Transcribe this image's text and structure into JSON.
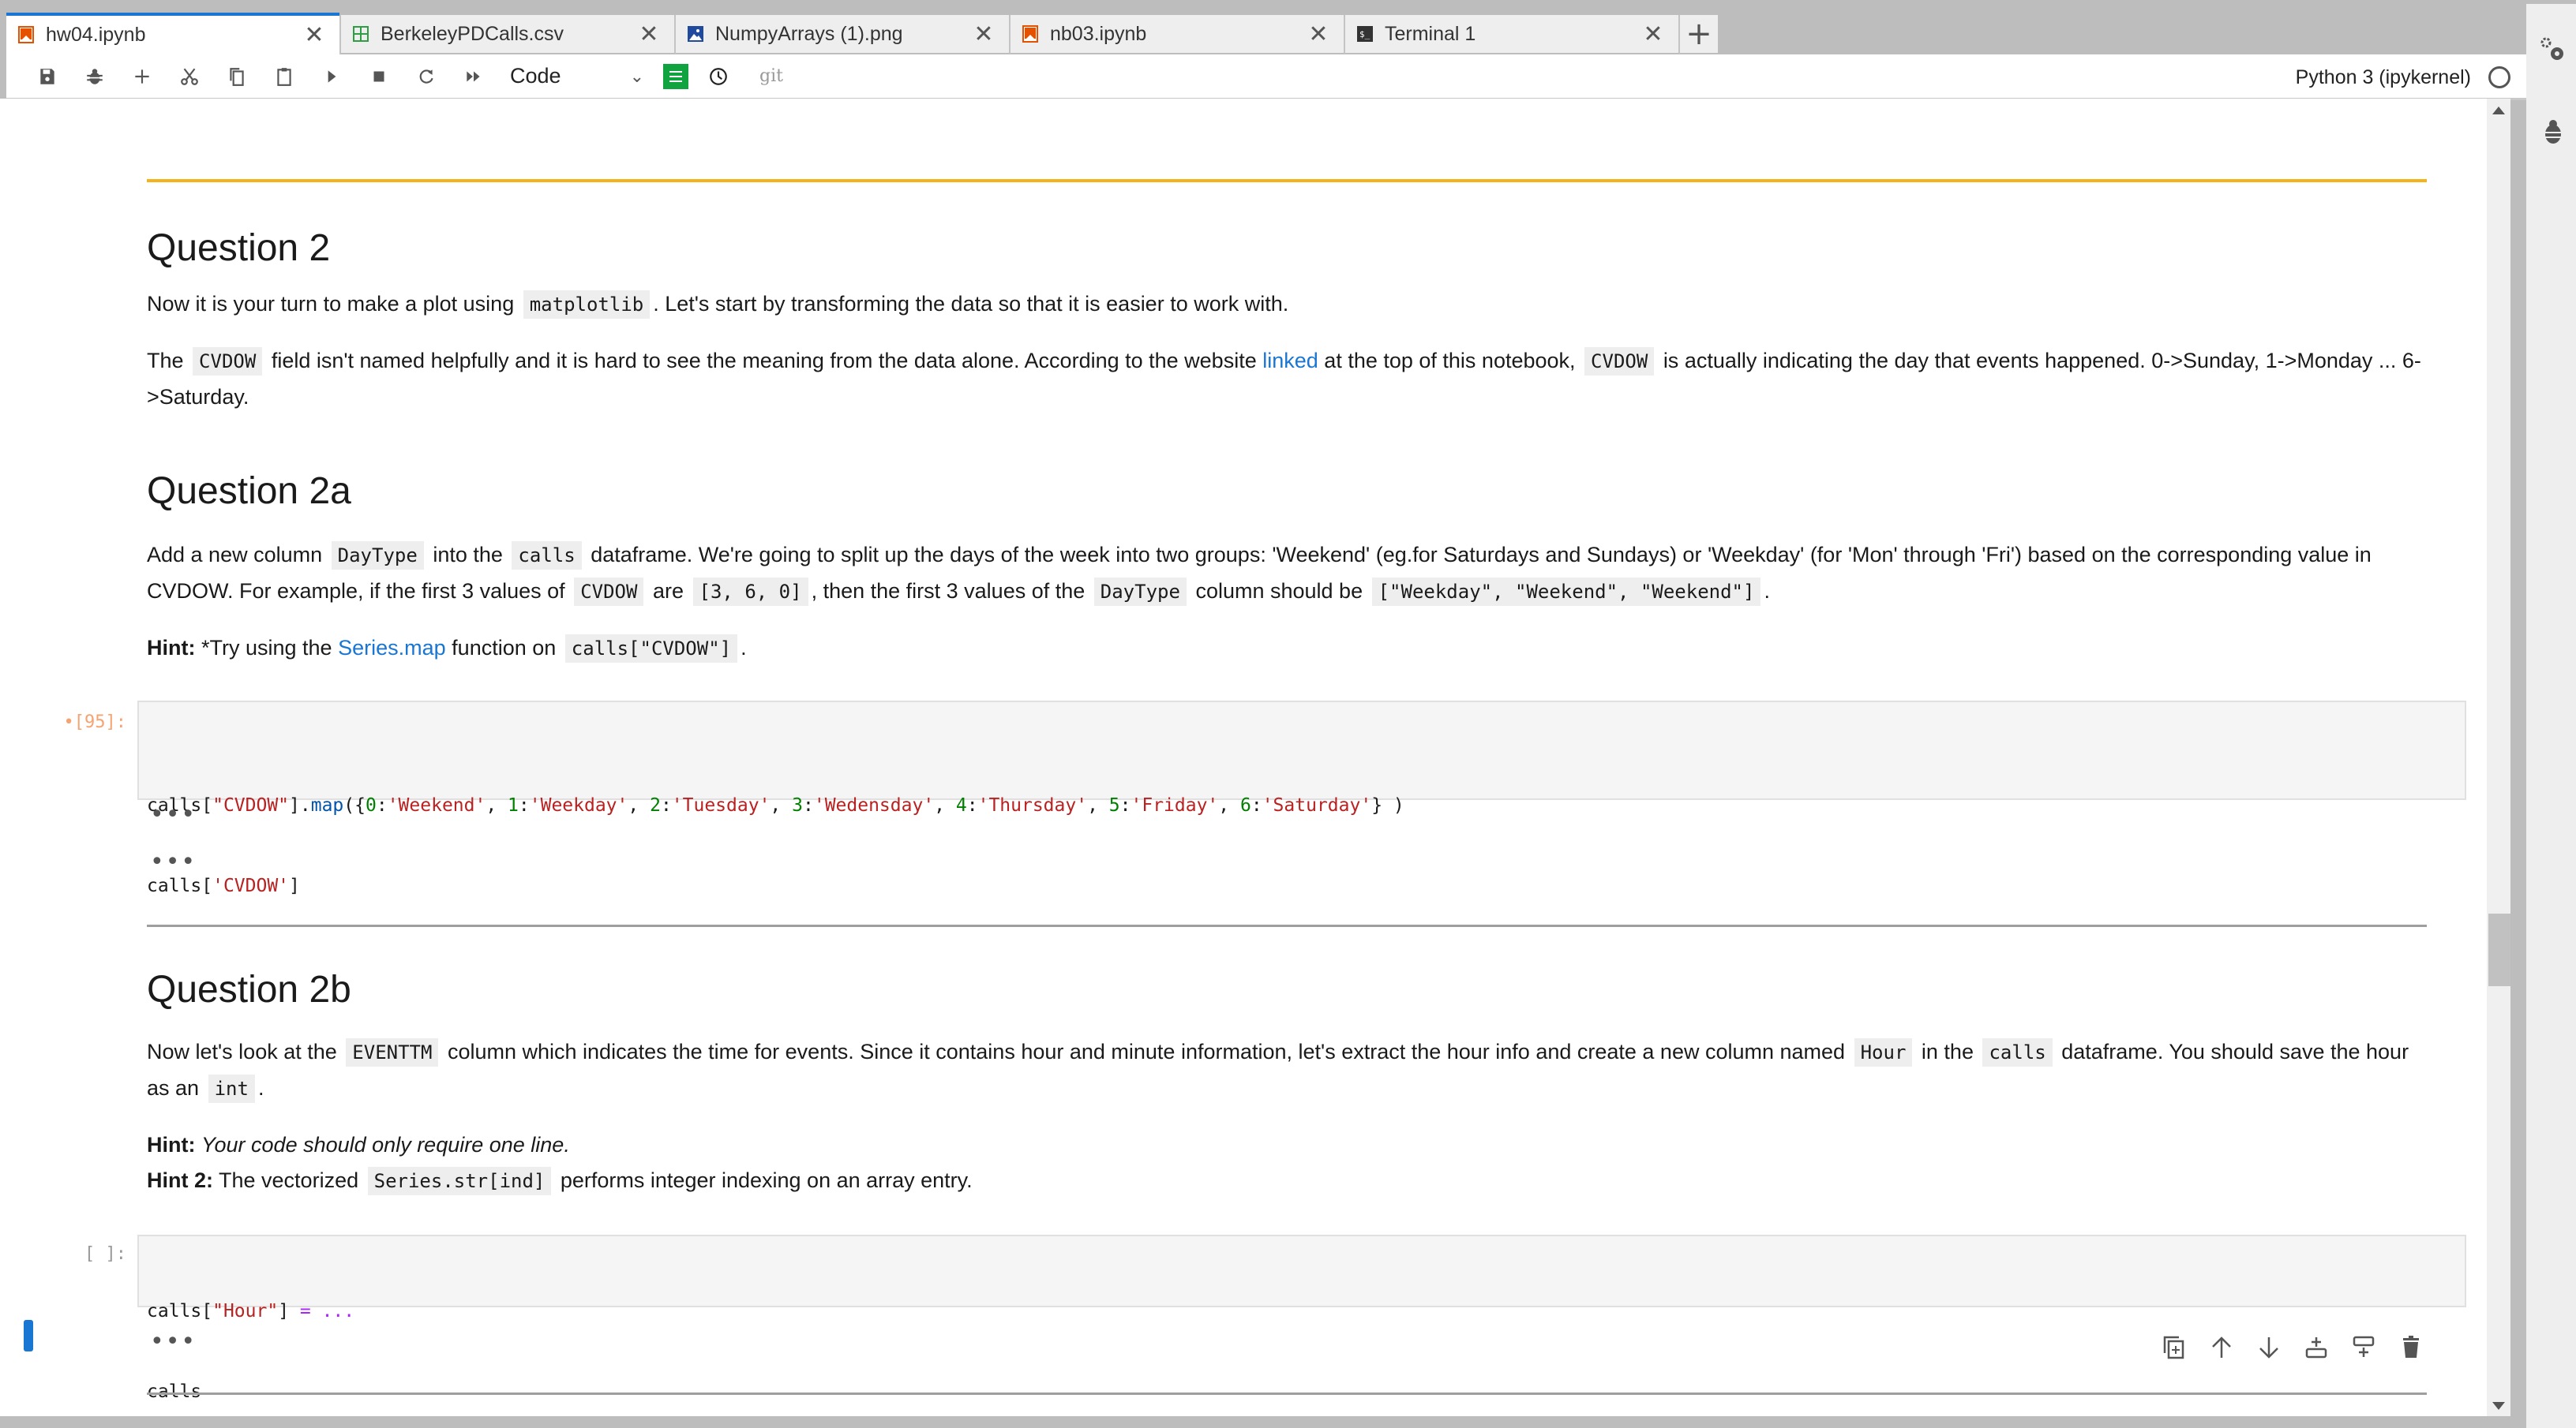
{
  "tabs": [
    {
      "label": "hw04.ipynb",
      "icon": "notebook-icon",
      "active": true
    },
    {
      "label": "BerkeleyPDCalls.csv",
      "icon": "spreadsheet-icon",
      "active": false
    },
    {
      "label": "NumpyArrays (1).png",
      "icon": "image-icon",
      "active": false
    },
    {
      "label": "nb03.ipynb",
      "icon": "notebook-icon",
      "active": false
    },
    {
      "label": "Terminal 1",
      "icon": "terminal-icon",
      "active": false
    }
  ],
  "tab_close_glyph": "✕",
  "tab_add_glyph": "+",
  "toolbar": {
    "buttons": [
      "save",
      "debug",
      "add-cell",
      "cut",
      "copy",
      "paste",
      "run",
      "stop",
      "restart",
      "run-all"
    ],
    "cell_type": "Code",
    "git_label": "git",
    "kernel_name": "Python 3 (ipykernel)"
  },
  "notebook": {
    "q2": {
      "heading": "Question 2",
      "p1_before": "Now it is your turn to make a plot using",
      "p1_code": "matplotlib",
      "p1_after": ". Let's start by transforming the data so that it is easier to work with.",
      "p2_a": "The",
      "p2_code1": "CVDOW",
      "p2_b": "field isn't named helpfully and it is hard to see the meaning from the data alone. According to the website",
      "p2_link": "linked",
      "p2_c": "at the top of this notebook,",
      "p2_code2": "CVDOW",
      "p2_d": "is actually indicating the day that events happened. 0->Sunday, 1->Monday ... 6->Saturday."
    },
    "q2a": {
      "heading": "Question 2a",
      "p1_a": "Add a new column",
      "p1_code1": "DayType",
      "p1_b": "into the",
      "p1_code2": "calls",
      "p1_c": "dataframe. We're going to split up the days of the week into two groups: 'Weekend' (eg.for Saturdays and Sundays) or 'Weekday' (for 'Mon' through 'Fri') based on the corresponding value in CVDOW. For example, if the first 3 values of",
      "p1_code3": "CVDOW",
      "p1_d": "are",
      "p1_code4": "[3, 6, 0]",
      "p1_e": ", then the first 3 values of the",
      "p1_code5": "DayType",
      "p1_f": "column should be",
      "p1_code6": "[\"Weekday\", \"Weekend\", \"Weekend\"]",
      "p1_g": ".",
      "hint_label": "Hint:",
      "hint_a": "*Try using the",
      "hint_link": "Series.map",
      "hint_b": "function on",
      "hint_code": "calls[\"CVDOW\"]",
      "hint_c": "."
    },
    "cell1": {
      "prompt": "•[95]:",
      "line1": [
        {
          "t": "calls[",
          "c": ""
        },
        {
          "t": "\"CVDOW\"",
          "c": "s"
        },
        {
          "t": "].",
          "c": ""
        },
        {
          "t": "map",
          "c": "f"
        },
        {
          "t": "({",
          "c": ""
        },
        {
          "t": "0",
          "c": "n"
        },
        {
          "t": ":",
          "c": ""
        },
        {
          "t": "'Weekend'",
          "c": "s"
        },
        {
          "t": ", ",
          "c": ""
        },
        {
          "t": "1",
          "c": "n"
        },
        {
          "t": ":",
          "c": ""
        },
        {
          "t": "'Weekday'",
          "c": "s"
        },
        {
          "t": ", ",
          "c": ""
        },
        {
          "t": "2",
          "c": "n"
        },
        {
          "t": ":",
          "c": ""
        },
        {
          "t": "'Tuesday'",
          "c": "s"
        },
        {
          "t": ", ",
          "c": ""
        },
        {
          "t": "3",
          "c": "n"
        },
        {
          "t": ":",
          "c": ""
        },
        {
          "t": "'Wedensday'",
          "c": "s"
        },
        {
          "t": ", ",
          "c": ""
        },
        {
          "t": "4",
          "c": "n"
        },
        {
          "t": ":",
          "c": ""
        },
        {
          "t": "'Thursday'",
          "c": "s"
        },
        {
          "t": ", ",
          "c": ""
        },
        {
          "t": "5",
          "c": "n"
        },
        {
          "t": ":",
          "c": ""
        },
        {
          "t": "'Friday'",
          "c": "s"
        },
        {
          "t": ", ",
          "c": ""
        },
        {
          "t": "6",
          "c": "n"
        },
        {
          "t": ":",
          "c": ""
        },
        {
          "t": "'Saturday'",
          "c": "s"
        },
        {
          "t": "} )",
          "c": ""
        }
      ],
      "line2": [
        {
          "t": "calls[",
          "c": ""
        },
        {
          "t": "'CVDOW'",
          "c": "s"
        },
        {
          "t": "]",
          "c": ""
        }
      ],
      "collapsed_outputs": [
        "•••",
        "•••"
      ]
    },
    "q2b": {
      "heading": "Question 2b",
      "p1_a": "Now let's look at the",
      "p1_code1": "EVENTTM",
      "p1_b": "column which indicates the time for events. Since it contains hour and minute information, let's extract the hour info and create a new column named",
      "p1_code2": "Hour",
      "p1_c": "in the",
      "p1_code3": "calls",
      "p1_d": "dataframe. You should save the hour as an",
      "p1_code4": "int",
      "p1_e": ".",
      "hint_label": "Hint:",
      "hint_text": "Your code should only require one line.",
      "hint2_label": "Hint 2:",
      "hint2_a": "The vectorized",
      "hint2_code": "Series.str[ind]",
      "hint2_b": "performs integer indexing on an array entry."
    },
    "cell2": {
      "prompt": "[ ]:",
      "line1": [
        {
          "t": "calls[",
          "c": ""
        },
        {
          "t": "\"Hour\"",
          "c": "s"
        },
        {
          "t": "] ",
          "c": ""
        },
        {
          "t": "= ...",
          "c": "op"
        }
      ],
      "line2": [
        {
          "t": "calls",
          "c": ""
        }
      ],
      "collapsed_output": "•••"
    },
    "cell_tools": [
      "duplicate-cell",
      "move-up",
      "move-down",
      "insert-above",
      "insert-below",
      "delete-cell"
    ]
  },
  "colors": {
    "accent": "#1976d2",
    "orange_rule": "#f6b21a",
    "prompt_running": "#f5a371",
    "string": "#ba2121",
    "number": "#008000"
  }
}
